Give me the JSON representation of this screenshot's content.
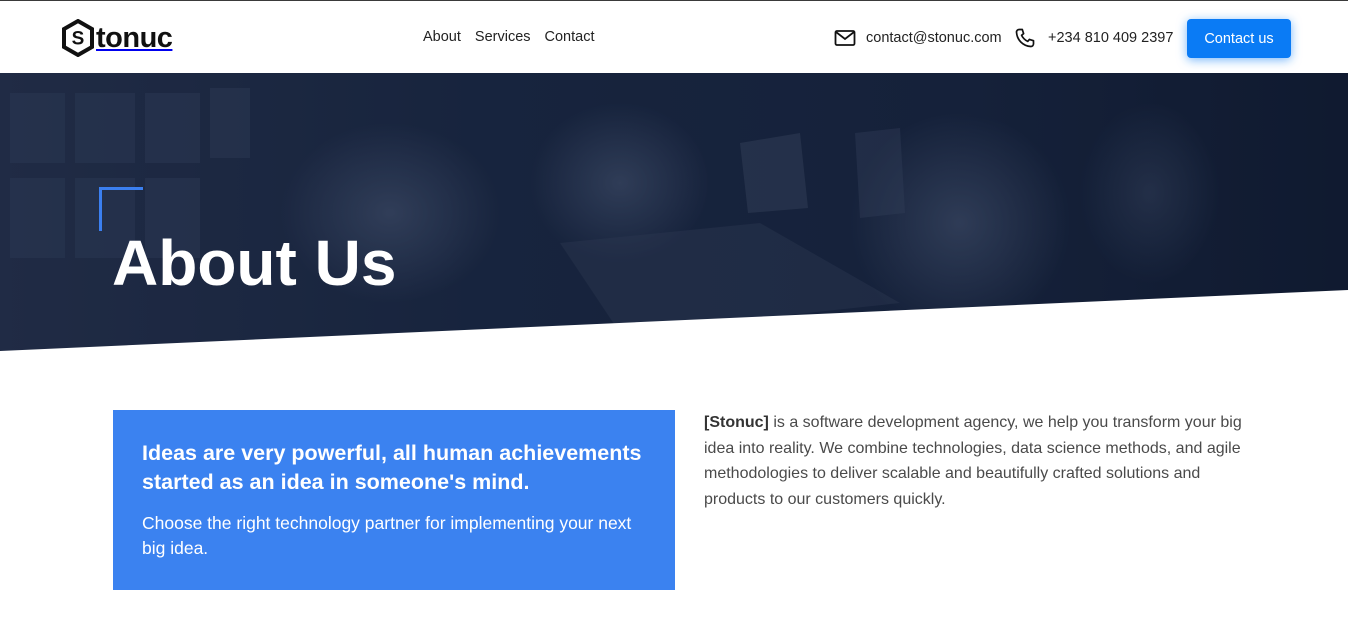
{
  "brand": {
    "name": "Stonuc",
    "logo_text": "tonuc",
    "logo_letter": "S"
  },
  "nav": {
    "items": [
      {
        "label": "About"
      },
      {
        "label": "Services"
      },
      {
        "label": "Contact"
      }
    ]
  },
  "contact": {
    "email": "contact@stonuc.com",
    "phone": "+234 810 409 2397",
    "email_icon": "mail-icon",
    "phone_icon": "phone-icon"
  },
  "cta": {
    "label": "Contact us",
    "color": "#0a7bf5"
  },
  "hero": {
    "title": "About Us",
    "accent_color": "#3b7ff0",
    "overlay_color": "#0f1a30"
  },
  "quote_card": {
    "title": "Ideas are very powerful, all human achievements started as an idea in someone's mind.",
    "subtitle": "Choose the right technology partner for implementing your next big idea.",
    "background": "#3b82f0"
  },
  "about": {
    "company_tag": "[Stonuc]",
    "body": " is a software development agency, we help you transform your big idea into reality. We combine technologies, data science methods, and agile methodologies to deliver scalable and beautifully crafted solutions and products to our customers quickly."
  }
}
